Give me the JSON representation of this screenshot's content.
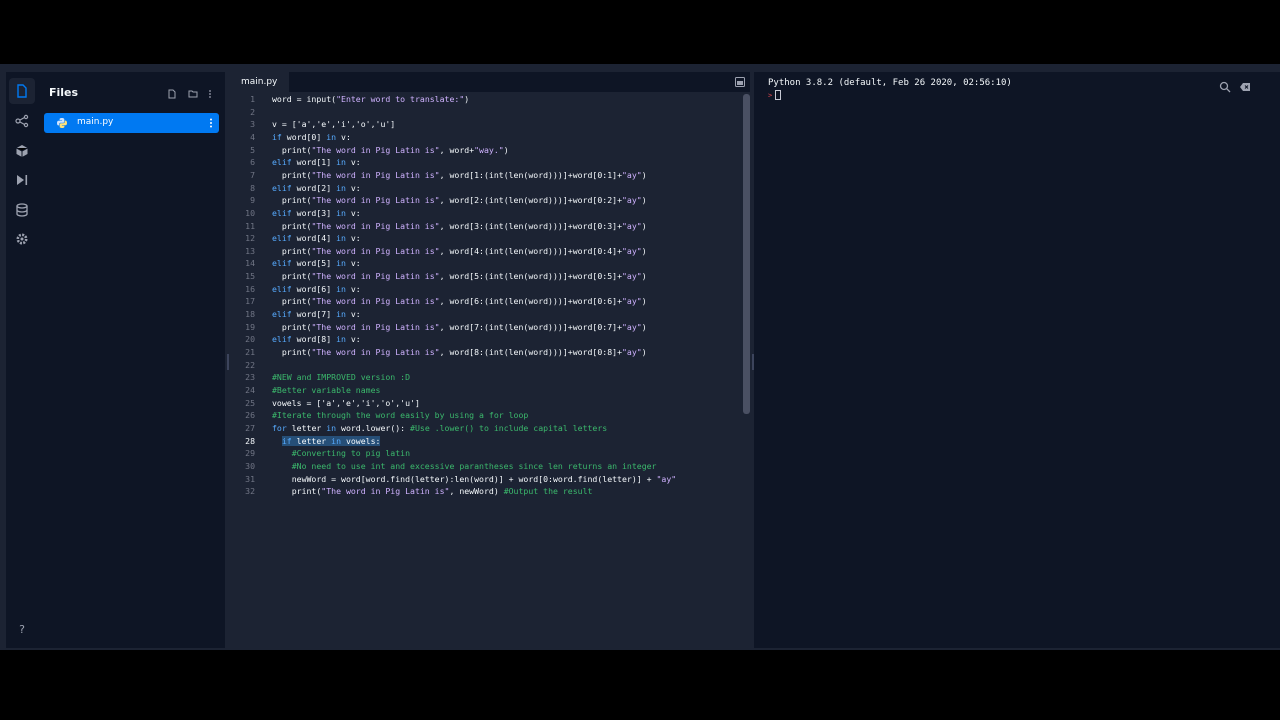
{
  "files_panel": {
    "title": "Files",
    "file": "main.py"
  },
  "editor": {
    "tab_label": "main.py",
    "cursor_line": 28
  },
  "console": {
    "banner": "Python 3.8.2 (default, Feb 26 2020, 02:56:10)",
    "prompt": ">"
  },
  "code_lines": [
    {
      "n": "1",
      "t": [
        [
          "p",
          "word = input(\"Enter word to translate:\")"
        ]
      ]
    },
    {
      "n": "2",
      "t": [
        [
          "p",
          ""
        ]
      ]
    },
    {
      "n": "3",
      "t": [
        [
          "p",
          "v = ['a','e','i','o','u']"
        ]
      ]
    },
    {
      "n": "4",
      "t": [
        [
          "k",
          "if"
        ],
        [
          "p",
          " word[0] "
        ],
        [
          "k",
          "in"
        ],
        [
          "p",
          " v:"
        ]
      ]
    },
    {
      "n": "5",
      "t": [
        [
          "p",
          "  print(\"The word in Pig Latin is\", word+\"way.\")"
        ]
      ]
    },
    {
      "n": "6",
      "t": [
        [
          "k",
          "elif"
        ],
        [
          "p",
          " word[1] "
        ],
        [
          "k",
          "in"
        ],
        [
          "p",
          " v:"
        ]
      ]
    },
    {
      "n": "7",
      "t": [
        [
          "p",
          "  print(\"The word in Pig Latin is\", word[1:(int(len(word)))]+word[0:1]+\"ay\")"
        ]
      ]
    },
    {
      "n": "8",
      "t": [
        [
          "k",
          "elif"
        ],
        [
          "p",
          " word[2] "
        ],
        [
          "k",
          "in"
        ],
        [
          "p",
          " v:"
        ]
      ]
    },
    {
      "n": "9",
      "t": [
        [
          "p",
          "  print(\"The word in Pig Latin is\", word[2:(int(len(word)))]+word[0:2]+\"ay\")"
        ]
      ]
    },
    {
      "n": "10",
      "t": [
        [
          "k",
          "elif"
        ],
        [
          "p",
          " word[3] "
        ],
        [
          "k",
          "in"
        ],
        [
          "p",
          " v:"
        ]
      ]
    },
    {
      "n": "11",
      "t": [
        [
          "p",
          "  print(\"The word in Pig Latin is\", word[3:(int(len(word)))]+word[0:3]+\"ay\")"
        ]
      ]
    },
    {
      "n": "12",
      "t": [
        [
          "k",
          "elif"
        ],
        [
          "p",
          " word[4] "
        ],
        [
          "k",
          "in"
        ],
        [
          "p",
          " v:"
        ]
      ]
    },
    {
      "n": "13",
      "t": [
        [
          "p",
          "  print(\"The word in Pig Latin is\", word[4:(int(len(word)))]+word[0:4]+\"ay\")"
        ]
      ]
    },
    {
      "n": "14",
      "t": [
        [
          "k",
          "elif"
        ],
        [
          "p",
          " word[5] "
        ],
        [
          "k",
          "in"
        ],
        [
          "p",
          " v:"
        ]
      ]
    },
    {
      "n": "15",
      "t": [
        [
          "p",
          "  print(\"The word in Pig Latin is\", word[5:(int(len(word)))]+word[0:5]+\"ay\")"
        ]
      ]
    },
    {
      "n": "16",
      "t": [
        [
          "k",
          "elif"
        ],
        [
          "p",
          " word[6] "
        ],
        [
          "k",
          "in"
        ],
        [
          "p",
          " v:"
        ]
      ]
    },
    {
      "n": "17",
      "t": [
        [
          "p",
          "  print(\"The word in Pig Latin is\", word[6:(int(len(word)))]+word[0:6]+\"ay\")"
        ]
      ]
    },
    {
      "n": "18",
      "t": [
        [
          "k",
          "elif"
        ],
        [
          "p",
          " word[7] "
        ],
        [
          "k",
          "in"
        ],
        [
          "p",
          " v:"
        ]
      ]
    },
    {
      "n": "19",
      "t": [
        [
          "p",
          "  print(\"The word in Pig Latin is\", word[7:(int(len(word)))]+word[0:7]+\"ay\")"
        ]
      ]
    },
    {
      "n": "20",
      "t": [
        [
          "k",
          "elif"
        ],
        [
          "p",
          " word[8] "
        ],
        [
          "k",
          "in"
        ],
        [
          "p",
          " v:"
        ]
      ]
    },
    {
      "n": "21",
      "t": [
        [
          "p",
          "  print(\"The word in Pig Latin is\", word[8:(int(len(word)))]+word[0:8]+\"ay\")"
        ]
      ]
    },
    {
      "n": "22",
      "t": [
        [
          "p",
          ""
        ]
      ]
    },
    {
      "n": "23",
      "t": [
        [
          "c",
          "#NEW and IMPROVED version :D"
        ]
      ]
    },
    {
      "n": "24",
      "t": [
        [
          "c",
          "#Better variable names"
        ]
      ]
    },
    {
      "n": "25",
      "t": [
        [
          "p",
          "vowels = ['a','e','i','o','u']"
        ]
      ]
    },
    {
      "n": "26",
      "t": [
        [
          "c",
          "#Iterate through the word easily by using a for loop"
        ]
      ]
    },
    {
      "n": "27",
      "t": [
        [
          "k",
          "for"
        ],
        [
          "p",
          " letter "
        ],
        [
          "k",
          "in"
        ],
        [
          "p",
          " word.lower(): "
        ],
        [
          "c",
          "#Use .lower() to include capital letters"
        ]
      ]
    },
    {
      "n": "28",
      "t": [
        [
          "p",
          "  "
        ],
        [
          "ks",
          "if"
        ],
        [
          "ps",
          " letter "
        ],
        [
          "ks",
          "in"
        ],
        [
          "ps",
          " vowels:"
        ]
      ]
    },
    {
      "n": "29",
      "t": [
        [
          "p",
          "    "
        ],
        [
          "c",
          "#Converting to pig latin"
        ]
      ]
    },
    {
      "n": "30",
      "t": [
        [
          "p",
          "    "
        ],
        [
          "c",
          "#No need to use int and excessive parantheses since len returns an integer"
        ]
      ]
    },
    {
      "n": "31",
      "t": [
        [
          "p",
          "    newWord = word[word.find(letter):len(word)] + word[0:word.find(letter)] + \"ay\""
        ]
      ]
    },
    {
      "n": "32",
      "t": [
        [
          "p",
          "    print(\"The word in Pig Latin is\", newWord) "
        ],
        [
          "c",
          "#Output the result"
        ]
      ]
    }
  ],
  "icons": {
    "rail": [
      "files-icon",
      "git-icon",
      "packages-icon",
      "debugger-icon",
      "database-icon",
      "settings-icon",
      "help-icon"
    ],
    "files_panel": [
      "new-file-icon",
      "new-folder-icon",
      "more-icon"
    ],
    "console": [
      "search-icon",
      "clear-console-icon"
    ]
  },
  "colors": {
    "accent": "#0079f2",
    "keyword": "#57abff",
    "comment": "#3bb86c",
    "string": "#cfb2ff"
  }
}
